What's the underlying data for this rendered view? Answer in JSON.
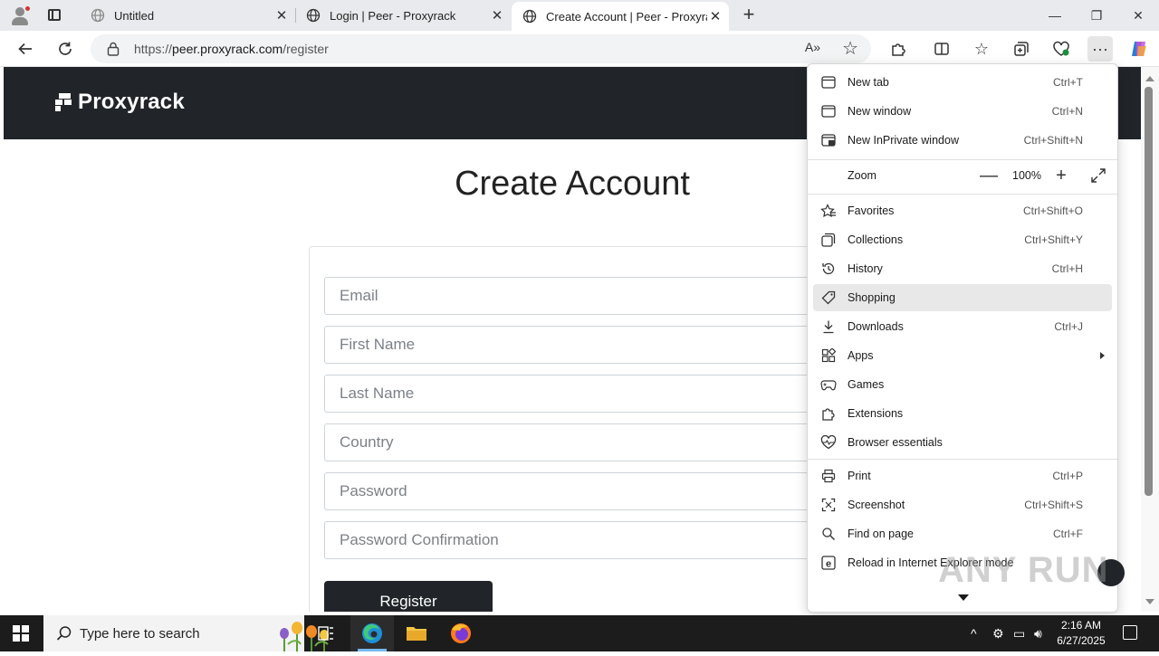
{
  "browser": {
    "tabs": [
      {
        "title": "Untitled",
        "active": false
      },
      {
        "title": "Login | Peer - Proxyrack",
        "active": false
      },
      {
        "title": "Create Account | Peer - Proxyrack",
        "active": true
      }
    ],
    "window_controls": {
      "minimize": "—",
      "maximize": "❐",
      "close": "✕"
    },
    "address": {
      "scheme": "https://",
      "host": "peer.proxyrack.com",
      "path": "/register"
    },
    "read_aloud": "A»"
  },
  "page": {
    "brand": "Proxyrack",
    "title": "Create Account",
    "form": {
      "email_placeholder": "Email",
      "first_name_placeholder": "First Name",
      "last_name_placeholder": "Last Name",
      "country_placeholder": "Country",
      "password_placeholder": "Password",
      "password_confirm_placeholder": "Password Confirmation",
      "register_label": "Register"
    },
    "colors": {
      "header_bg": "#212529",
      "button_bg": "#212529"
    }
  },
  "menu": {
    "items": [
      {
        "label": "New tab",
        "shortcut": "Ctrl+T",
        "icon": "new-tab-icon"
      },
      {
        "label": "New window",
        "shortcut": "Ctrl+N",
        "icon": "new-window-icon"
      },
      {
        "label": "New InPrivate window",
        "shortcut": "Ctrl+Shift+N",
        "icon": "inprivate-icon"
      },
      {
        "label": "Zoom",
        "value": "100%",
        "minus": "—",
        "plus": "+"
      },
      {
        "label": "Favorites",
        "shortcut": "Ctrl+Shift+O",
        "icon": "favorites-icon"
      },
      {
        "label": "Collections",
        "shortcut": "Ctrl+Shift+Y",
        "icon": "collections-icon"
      },
      {
        "label": "History",
        "shortcut": "Ctrl+H",
        "icon": "history-icon"
      },
      {
        "label": "Shopping",
        "shortcut": "",
        "icon": "shopping-tag-icon",
        "highlighted": true
      },
      {
        "label": "Downloads",
        "shortcut": "Ctrl+J",
        "icon": "download-icon"
      },
      {
        "label": "Apps",
        "shortcut": "",
        "icon": "apps-icon",
        "submenu": true
      },
      {
        "label": "Games",
        "shortcut": "",
        "icon": "games-icon"
      },
      {
        "label": "Extensions",
        "shortcut": "",
        "icon": "extensions-icon"
      },
      {
        "label": "Browser essentials",
        "shortcut": "",
        "icon": "heart-pulse-icon"
      },
      {
        "label": "Print",
        "shortcut": "Ctrl+P",
        "icon": "print-icon"
      },
      {
        "label": "Screenshot",
        "shortcut": "Ctrl+Shift+S",
        "icon": "screenshot-icon"
      },
      {
        "label": "Find on page",
        "shortcut": "Ctrl+F",
        "icon": "find-icon"
      },
      {
        "label": "Reload in Internet Explorer mode",
        "shortcut": "",
        "icon": "ie-mode-icon"
      }
    ]
  },
  "watermark": "ANY RUN",
  "taskbar": {
    "search_placeholder": "Type here to search",
    "time": "2:16 AM",
    "date": "6/27/2025"
  }
}
